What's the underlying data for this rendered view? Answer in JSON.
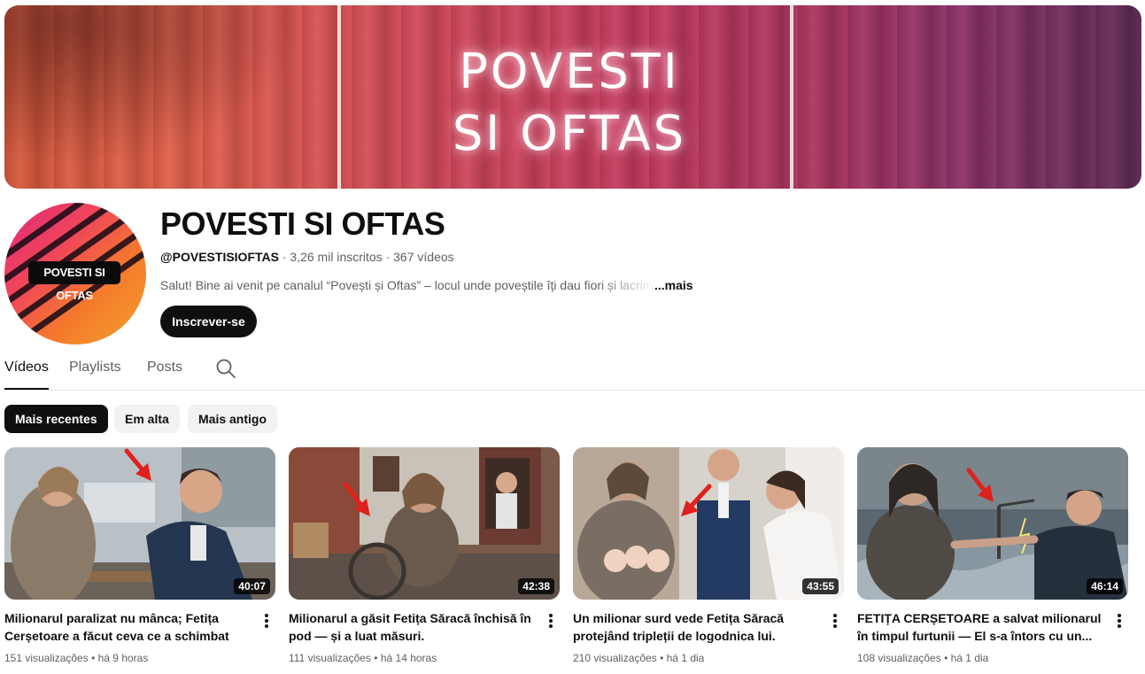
{
  "banner": {
    "line1": "POVESTI",
    "line2": "SI OFTAS"
  },
  "avatar": {
    "badge": "POVESTI SI OFTAS"
  },
  "channel": {
    "name": "POVESTI SI OFTAS",
    "handle": "@POVESTISIOFTAS",
    "subscribers": "3,26 mil inscritos",
    "videos": "367 vídeos",
    "description": "Salut! Bine ai venit pe canalul “Povești și Oftas” – locul unde poveștile îți dau fiori și lacrimi",
    "more_label": "...mais",
    "subscribe_label": "Inscrever-se"
  },
  "tabs": [
    {
      "label": "Vídeos",
      "active": true
    },
    {
      "label": "Playlists",
      "active": false
    },
    {
      "label": "Posts",
      "active": false
    }
  ],
  "chips": [
    {
      "label": "Mais recentes",
      "active": true
    },
    {
      "label": "Em alta",
      "active": false
    },
    {
      "label": "Mais antigo",
      "active": false
    }
  ],
  "videos": [
    {
      "title": "Milionarul paralizat nu mânca; Fetița Cerșetoare a făcut ceva ce a schimbat totul.",
      "duration": "40:07",
      "views": "151 visualizações",
      "age": "há 9 horas"
    },
    {
      "title": "Milionarul a găsit Fetița Săracă închisă în pod — și a luat măsuri.",
      "duration": "42:38",
      "views": "111 visualizações",
      "age": "há 14 horas"
    },
    {
      "title": "Un milionar surd vede Fetița Săracă protejând tripleții de logodnica lui.",
      "duration": "43:55",
      "views": "210 visualizações",
      "age": "há 1 dia"
    },
    {
      "title": "FETIȚA CERȘETOARE a salvat milionarul în timpul furtunii — El s-a întors cu un...",
      "duration": "46:14",
      "views": "108 visualizações",
      "age": "há 1 dia"
    }
  ],
  "colors": {
    "accent": "#0f0f0f",
    "secondary_text": "#606060",
    "chip_bg": "#f2f2f2",
    "arrow": "#e0201c"
  }
}
